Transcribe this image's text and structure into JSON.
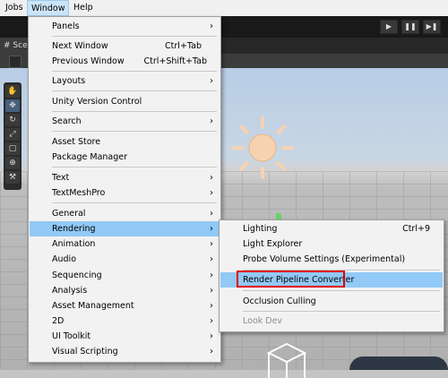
{
  "menubar": {
    "items": [
      "Jobs",
      "Window",
      "Help"
    ]
  },
  "toolbar": {
    "play": "▶",
    "pause": "❚❚",
    "step": "▶❚"
  },
  "scene": {
    "tab_label": "# Sce",
    "tool_icons": [
      "hand-icon",
      "move-icon",
      "rotate-icon",
      "scale-icon",
      "rect-icon",
      "transform-icon",
      "custom-tool-icon"
    ]
  },
  "window_menu": {
    "items": [
      {
        "label": "Panels",
        "arrow": "›"
      },
      {
        "label": "Next Window",
        "shortcut": "Ctrl+Tab"
      },
      {
        "label": "Previous Window",
        "shortcut": "Ctrl+Shift+Tab"
      },
      {
        "label": "Layouts",
        "arrow": "›"
      },
      {
        "label": "Unity Version Control"
      },
      {
        "label": "Search",
        "arrow": "›"
      },
      {
        "label": "Asset Store"
      },
      {
        "label": "Package Manager"
      },
      {
        "label": "Text",
        "arrow": "›"
      },
      {
        "label": "TextMeshPro",
        "arrow": "›"
      },
      {
        "label": "General",
        "arrow": "›"
      },
      {
        "label": "Rendering",
        "arrow": "›"
      },
      {
        "label": "Animation",
        "arrow": "›"
      },
      {
        "label": "Audio",
        "arrow": "›"
      },
      {
        "label": "Sequencing",
        "arrow": "›"
      },
      {
        "label": "Analysis",
        "arrow": "›"
      },
      {
        "label": "Asset Management",
        "arrow": "›"
      },
      {
        "label": "2D",
        "arrow": "›"
      },
      {
        "label": "UI Toolkit",
        "arrow": "›"
      },
      {
        "label": "Visual Scripting",
        "arrow": "›"
      }
    ]
  },
  "rendering_submenu": {
    "items": [
      {
        "label": "Lighting",
        "shortcut": "Ctrl+9"
      },
      {
        "label": "Light Explorer"
      },
      {
        "label": "Probe Volume Settings (Experimental)"
      },
      {
        "label": "Render Pipeline Converter"
      },
      {
        "label": "Occlusion Culling"
      },
      {
        "label": "Look Dev"
      }
    ]
  },
  "colors": {
    "highlight": "#91c9f7",
    "annotation_box": "#e00000",
    "menu_bg": "#f2f2f2"
  }
}
